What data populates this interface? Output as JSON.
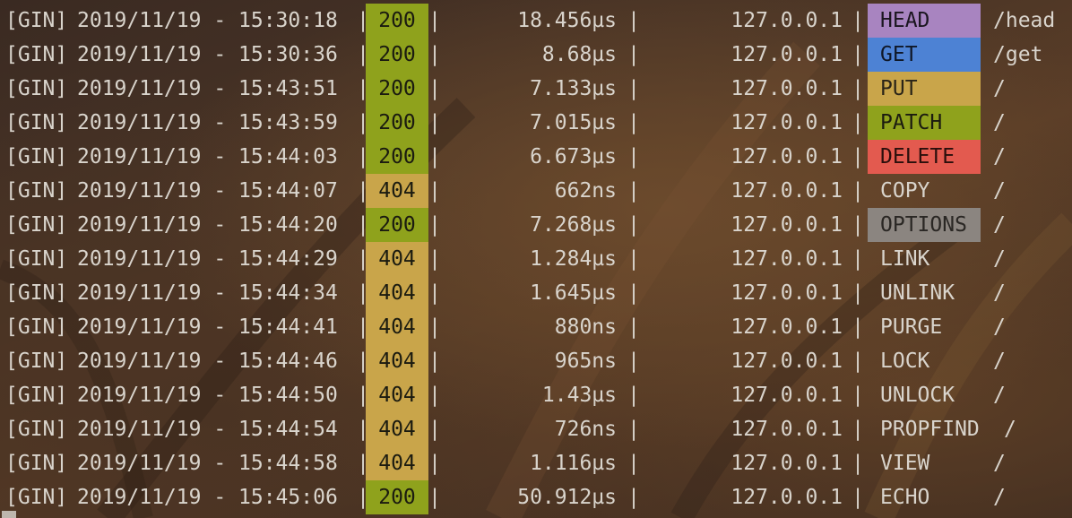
{
  "log": {
    "prefix": "[GIN]",
    "separator": "|",
    "entries": [
      {
        "timestamp": "2019/11/19 - 15:30:18",
        "status": "200",
        "latency": "18.456µs",
        "ip": "127.0.0.1",
        "method": "HEAD",
        "path": "/head"
      },
      {
        "timestamp": "2019/11/19 - 15:30:36",
        "status": "200",
        "latency": "8.68µs",
        "ip": "127.0.0.1",
        "method": "GET",
        "path": "/get"
      },
      {
        "timestamp": "2019/11/19 - 15:43:51",
        "status": "200",
        "latency": "7.133µs",
        "ip": "127.0.0.1",
        "method": "PUT",
        "path": "/"
      },
      {
        "timestamp": "2019/11/19 - 15:43:59",
        "status": "200",
        "latency": "7.015µs",
        "ip": "127.0.0.1",
        "method": "PATCH",
        "path": "/"
      },
      {
        "timestamp": "2019/11/19 - 15:44:03",
        "status": "200",
        "latency": "6.673µs",
        "ip": "127.0.0.1",
        "method": "DELETE",
        "path": "/"
      },
      {
        "timestamp": "2019/11/19 - 15:44:07",
        "status": "404",
        "latency": "662ns",
        "ip": "127.0.0.1",
        "method": "COPY",
        "path": "/"
      },
      {
        "timestamp": "2019/11/19 - 15:44:20",
        "status": "200",
        "latency": "7.268µs",
        "ip": "127.0.0.1",
        "method": "OPTIONS",
        "path": "/"
      },
      {
        "timestamp": "2019/11/19 - 15:44:29",
        "status": "404",
        "latency": "1.284µs",
        "ip": "127.0.0.1",
        "method": "LINK",
        "path": "/"
      },
      {
        "timestamp": "2019/11/19 - 15:44:34",
        "status": "404",
        "latency": "1.645µs",
        "ip": "127.0.0.1",
        "method": "UNLINK",
        "path": "/"
      },
      {
        "timestamp": "2019/11/19 - 15:44:41",
        "status": "404",
        "latency": "880ns",
        "ip": "127.0.0.1",
        "method": "PURGE",
        "path": "/"
      },
      {
        "timestamp": "2019/11/19 - 15:44:46",
        "status": "404",
        "latency": "965ns",
        "ip": "127.0.0.1",
        "method": "LOCK",
        "path": "/"
      },
      {
        "timestamp": "2019/11/19 - 15:44:50",
        "status": "404",
        "latency": "1.43µs",
        "ip": "127.0.0.1",
        "method": "UNLOCK",
        "path": "/"
      },
      {
        "timestamp": "2019/11/19 - 15:44:54",
        "status": "404",
        "latency": "726ns",
        "ip": "127.0.0.1",
        "method": "PROPFIND",
        "path": "/"
      },
      {
        "timestamp": "2019/11/19 - 15:44:58",
        "status": "404",
        "latency": "1.116µs",
        "ip": "127.0.0.1",
        "method": "VIEW",
        "path": "/"
      },
      {
        "timestamp": "2019/11/19 - 15:45:06",
        "status": "200",
        "latency": "50.912µs",
        "ip": "127.0.0.1",
        "method": "ECHO",
        "path": "/"
      }
    ]
  },
  "colors": {
    "status_200": "#8fa21c",
    "status_404": "#c9a54a",
    "method_head": "#a884c0",
    "method_get": "#4d82d4",
    "method_put": "#c9a54a",
    "method_patch": "#8fa21c",
    "method_delete": "#e35a4f",
    "method_options": "#8b8580"
  }
}
